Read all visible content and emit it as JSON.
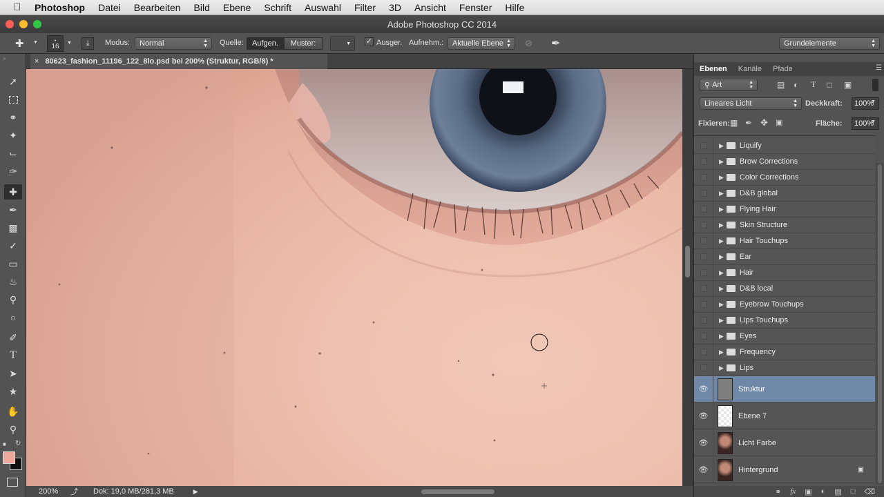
{
  "menubar": {
    "app_name": "Photoshop",
    "items": [
      "Datei",
      "Bearbeiten",
      "Bild",
      "Ebene",
      "Schrift",
      "Auswahl",
      "Filter",
      "3D",
      "Ansicht",
      "Fenster",
      "Hilfe"
    ]
  },
  "window": {
    "title": "Adobe Photoshop CC 2014"
  },
  "options": {
    "brush_size": "16",
    "modus_label": "Modus:",
    "modus_value": "Normal",
    "quelle_label": "Quelle:",
    "aufgen_label": "Aufgen.",
    "muster_label": "Muster:",
    "ausger_label": "Ausger.",
    "aufnehm_label": "Aufnehm.:",
    "aufnehm_value": "Aktuelle Ebene",
    "workspace_value": "Grundelemente"
  },
  "document": {
    "tab_title": "80623_fashion_11196_122_8lo.psd bei 200% (Struktur, RGB/8) *",
    "zoom": "200%",
    "doc_info": "Dok: 19,0 MB/281,3 MB"
  },
  "layers_panel": {
    "tabs": [
      "Ebenen",
      "Kanäle",
      "Pfade"
    ],
    "filter_value": "Art",
    "blend_mode": "Lineares Licht",
    "opacity_label": "Deckkraft:",
    "opacity_value": "100%",
    "lock_label": "Fixieren:",
    "fill_label": "Fläche:",
    "fill_value": "100%",
    "groups": [
      "Liquify",
      "Brow Corrections",
      "Color Corrections",
      "D&B global",
      "Flying Hair",
      "Skin Structure",
      "Hair Touchups",
      "Ear",
      "Hair",
      "D&B local",
      "Eyebrow Touchups",
      "Lips Touchups",
      "Eyes",
      "Frequency",
      "Lips"
    ],
    "layers": [
      "Struktur",
      "Ebene 7",
      "Licht Farbe",
      "Hintergrund"
    ],
    "selected_layer": "Struktur",
    "bottom_icons": [
      "link-icon",
      "fx-icon",
      "mask-icon",
      "adjustment-icon",
      "folder-icon",
      "new-layer-icon",
      "trash-icon"
    ]
  },
  "colors": {
    "selected_row": "#6f88a8",
    "skin": "#eebfae",
    "iris": "#4d5f78"
  }
}
